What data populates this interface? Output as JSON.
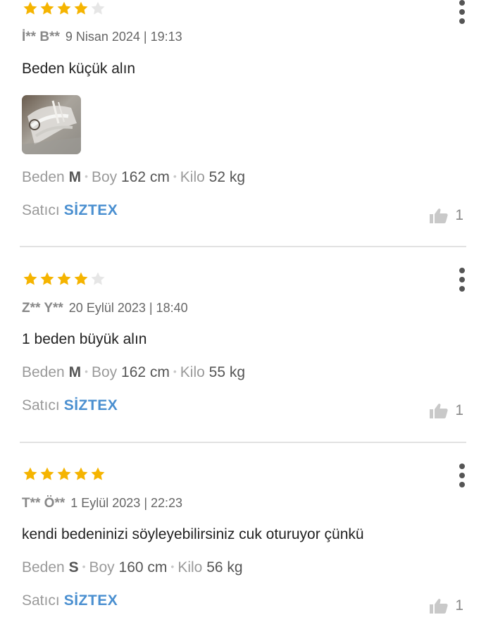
{
  "labels": {
    "beden": "Beden",
    "boy": "Boy",
    "kilo": "Kilo",
    "satici": "Satıcı",
    "separator": "•"
  },
  "colors": {
    "star_filled": "#f5b400",
    "star_empty": "#e6e6e6",
    "seller_name": "#4a8fd0",
    "divider": "#e2e2e2"
  },
  "icons": {
    "more": "kebab-menu-icon",
    "like": "thumbs-up-icon",
    "star": "star-icon"
  },
  "reviews": [
    {
      "rating": 4,
      "user": "İ** B**",
      "date": "9 Nisan 2024 | 19:13",
      "comment": "Beden küçük alın",
      "has_photo": true,
      "size_value": "M",
      "height_value": "162 cm",
      "weight_value": "52 kg",
      "seller_name": "SİZTEX",
      "likes": "1"
    },
    {
      "rating": 4,
      "user": "Z** Y**",
      "date": "20 Eylül 2023 | 18:40",
      "comment": "1 beden büyük alın",
      "has_photo": false,
      "size_value": "M",
      "height_value": "162 cm",
      "weight_value": "55 kg",
      "seller_name": "SİZTEX",
      "likes": "1"
    },
    {
      "rating": 5,
      "user": "T** Ö**",
      "date": "1 Eylül 2023 | 22:23",
      "comment": "kendi bedeninizi söyleyebilirsiniz cuk oturuyor çünkü",
      "has_photo": false,
      "size_value": "S",
      "height_value": "160 cm",
      "weight_value": "56 kg",
      "seller_name": "SİZTEX",
      "likes": "1"
    }
  ]
}
